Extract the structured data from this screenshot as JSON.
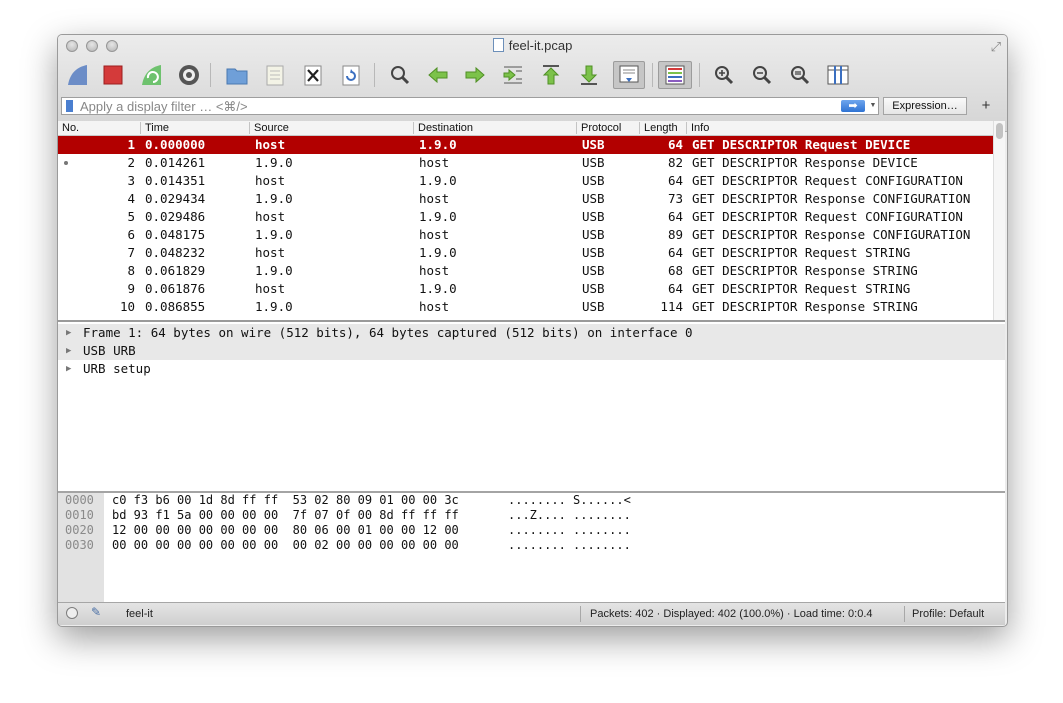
{
  "window": {
    "title": "feel-it.pcap"
  },
  "toolbar": {
    "buttons": [
      {
        "name": "start-capture-icon"
      },
      {
        "name": "stop-capture-icon"
      },
      {
        "name": "restart-capture-icon"
      },
      {
        "name": "capture-options-icon"
      },
      {
        "name": "open-file-icon"
      },
      {
        "name": "save-file-icon"
      },
      {
        "name": "close-file-icon"
      },
      {
        "name": "reload-file-icon"
      },
      {
        "name": "find-packet-icon"
      },
      {
        "name": "go-back-icon"
      },
      {
        "name": "go-forward-icon"
      },
      {
        "name": "go-to-packet-icon"
      },
      {
        "name": "go-first-packet-icon"
      },
      {
        "name": "go-last-packet-icon"
      },
      {
        "name": "auto-scroll-icon"
      },
      {
        "name": "colorize-icon"
      },
      {
        "name": "zoom-in-icon"
      },
      {
        "name": "zoom-out-icon"
      },
      {
        "name": "normal-size-icon"
      },
      {
        "name": "resize-columns-icon"
      }
    ]
  },
  "filter": {
    "placeholder": "Apply a display filter … <⌘/>",
    "expression_label": "Expression…",
    "plus_label": "+"
  },
  "packet_list": {
    "columns": [
      "No.",
      "Time",
      "Source",
      "Destination",
      "Protocol",
      "Length",
      "Info"
    ],
    "rows": [
      {
        "no": "1",
        "time": "0.000000",
        "source": "host",
        "destination": "1.9.0",
        "protocol": "USB",
        "length": "64",
        "info": "GET DESCRIPTOR Request DEVICE"
      },
      {
        "no": "2",
        "time": "0.014261",
        "source": "1.9.0",
        "destination": "host",
        "protocol": "USB",
        "length": "82",
        "info": "GET DESCRIPTOR Response DEVICE"
      },
      {
        "no": "3",
        "time": "0.014351",
        "source": "host",
        "destination": "1.9.0",
        "protocol": "USB",
        "length": "64",
        "info": "GET DESCRIPTOR Request CONFIGURATION"
      },
      {
        "no": "4",
        "time": "0.029434",
        "source": "1.9.0",
        "destination": "host",
        "protocol": "USB",
        "length": "73",
        "info": "GET DESCRIPTOR Response CONFIGURATION"
      },
      {
        "no": "5",
        "time": "0.029486",
        "source": "host",
        "destination": "1.9.0",
        "protocol": "USB",
        "length": "64",
        "info": "GET DESCRIPTOR Request CONFIGURATION"
      },
      {
        "no": "6",
        "time": "0.048175",
        "source": "1.9.0",
        "destination": "host",
        "protocol": "USB",
        "length": "89",
        "info": "GET DESCRIPTOR Response CONFIGURATION"
      },
      {
        "no": "7",
        "time": "0.048232",
        "source": "host",
        "destination": "1.9.0",
        "protocol": "USB",
        "length": "64",
        "info": "GET DESCRIPTOR Request STRING"
      },
      {
        "no": "8",
        "time": "0.061829",
        "source": "1.9.0",
        "destination": "host",
        "protocol": "USB",
        "length": "68",
        "info": "GET DESCRIPTOR Response STRING"
      },
      {
        "no": "9",
        "time": "0.061876",
        "source": "host",
        "destination": "1.9.0",
        "protocol": "USB",
        "length": "64",
        "info": "GET DESCRIPTOR Request STRING"
      },
      {
        "no": "10",
        "time": "0.086855",
        "source": "1.9.0",
        "destination": "host",
        "protocol": "USB",
        "length": "114",
        "info": "GET DESCRIPTOR Response STRING"
      }
    ],
    "selected_row_color": "#b20000"
  },
  "details": {
    "items": [
      {
        "label": "Frame 1: 64 bytes on wire (512 bits), 64 bytes captured (512 bits) on interface 0"
      },
      {
        "label": "USB URB"
      },
      {
        "label": "URB setup"
      }
    ]
  },
  "bytes": {
    "rows": [
      {
        "offset": "0000",
        "hex": "c0 f3 b6 00 1d 8d ff ff  53 02 80 09 01 00 00 3c",
        "ascii": "........ S......<"
      },
      {
        "offset": "0010",
        "hex": "bd 93 f1 5a 00 00 00 00  7f 07 0f 00 8d ff ff ff",
        "ascii": "...Z.... ........"
      },
      {
        "offset": "0020",
        "hex": "12 00 00 00 00 00 00 00  80 06 00 01 00 00 12 00",
        "ascii": "........ ........"
      },
      {
        "offset": "0030",
        "hex": "00 00 00 00 00 00 00 00  00 02 00 00 00 00 00 00",
        "ascii": "........ ........"
      }
    ]
  },
  "status": {
    "file": "feel-it",
    "packets": "Packets: 402 · Displayed: 402 (100.0%) · Load time: 0:0.4",
    "profile": "Profile: Default"
  }
}
